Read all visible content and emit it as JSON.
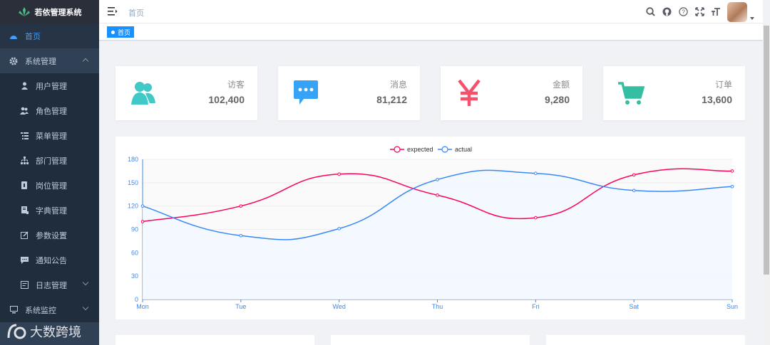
{
  "app": {
    "title": "若依管理系统"
  },
  "sidebar": {
    "items": [
      {
        "label": "首页",
        "icon": "dashboard-icon",
        "active": true
      },
      {
        "label": "系统管理",
        "icon": "gear-icon",
        "expanded": true
      },
      {
        "label": "用户管理",
        "icon": "user-icon"
      },
      {
        "label": "角色管理",
        "icon": "peoples-icon"
      },
      {
        "label": "菜单管理",
        "icon": "tree-table-icon"
      },
      {
        "label": "部门管理",
        "icon": "tree-icon"
      },
      {
        "label": "岗位管理",
        "icon": "post-icon"
      },
      {
        "label": "字典管理",
        "icon": "dict-icon"
      },
      {
        "label": "参数设置",
        "icon": "edit-icon"
      },
      {
        "label": "通知公告",
        "icon": "message-icon"
      },
      {
        "label": "日志管理",
        "icon": "log-icon"
      },
      {
        "label": "系统监控",
        "icon": "monitor-icon"
      }
    ]
  },
  "header": {
    "breadcrumb": "首页",
    "icons": [
      "search-icon",
      "github-icon",
      "question-icon",
      "fullscreen-icon",
      "font-size-icon"
    ]
  },
  "tags": {
    "active": "首页"
  },
  "cards": [
    {
      "label": "访客",
      "value": "102,400",
      "icon": "peoples-icon",
      "color": "#40c9c6"
    },
    {
      "label": "消息",
      "value": "81,212",
      "icon": "message-icon",
      "color": "#36a3f7"
    },
    {
      "label": "金额",
      "value": "9,280",
      "icon": "money-icon",
      "color": "#f4516c"
    },
    {
      "label": "订单",
      "value": "13,600",
      "icon": "shopping-icon",
      "color": "#34bfa3"
    }
  ],
  "chart_data": {
    "type": "line",
    "categories": [
      "Mon",
      "Tue",
      "Wed",
      "Thu",
      "Fri",
      "Sat",
      "Sun"
    ],
    "series": [
      {
        "name": "expected",
        "values": [
          100,
          120,
          161,
          134,
          105,
          160,
          165
        ],
        "color": "#ff005a"
      },
      {
        "name": "actual",
        "values": [
          120,
          82,
          91,
          154,
          162,
          140,
          145
        ],
        "color": "#3888fa"
      }
    ],
    "y_ticks": [
      "0",
      "30",
      "60",
      "90",
      "120",
      "150",
      "180"
    ],
    "ylim": [
      0,
      180
    ],
    "legend": "top-center",
    "grid": true
  },
  "watermark": "大数跨境"
}
